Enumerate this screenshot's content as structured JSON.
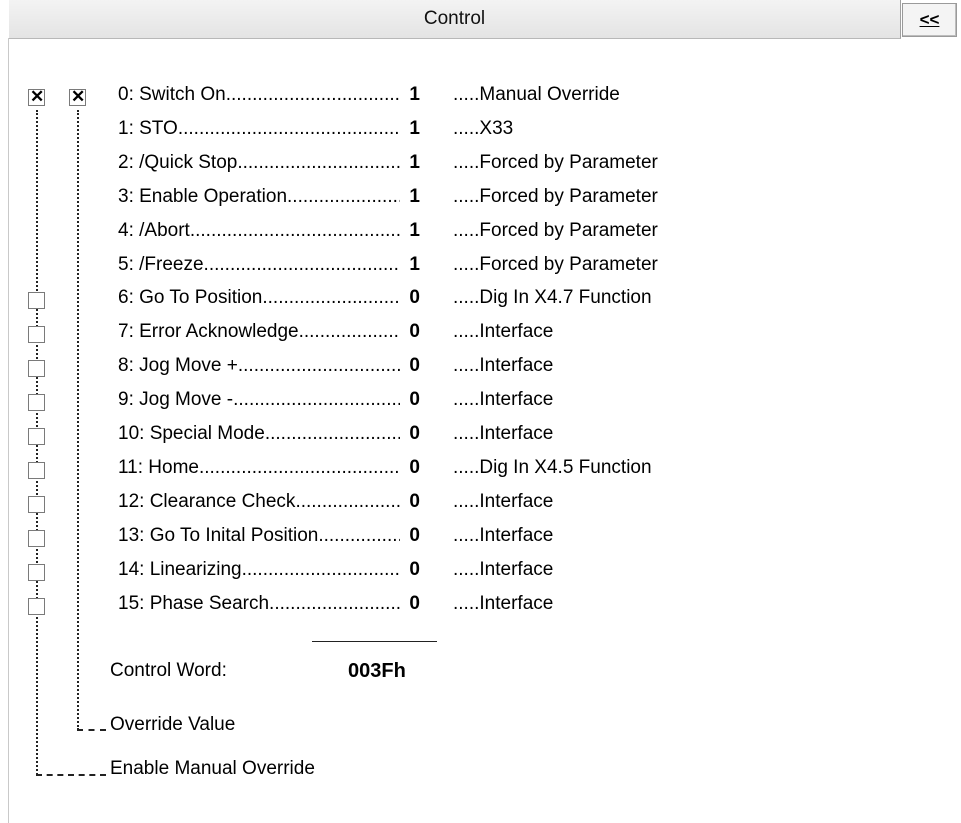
{
  "header": {
    "title": "Control",
    "collapse_label": "<<"
  },
  "bits": [
    {
      "label": "0: Switch On",
      "value": "1",
      "source": ".....Manual Override",
      "enable": true,
      "override": true
    },
    {
      "label": "1: STO",
      "value": "1",
      "source": ".....X33",
      "enable": null,
      "override": null
    },
    {
      "label": "2: /Quick Stop",
      "value": "1",
      "source": ".....Forced by Parameter",
      "enable": null,
      "override": null
    },
    {
      "label": "3: Enable Operation",
      "value": "1",
      "source": ".....Forced by Parameter",
      "enable": null,
      "override": null
    },
    {
      "label": "4: /Abort",
      "value": "1",
      "source": ".....Forced by Parameter",
      "enable": null,
      "override": null
    },
    {
      "label": "5: /Freeze",
      "value": "1",
      "source": ".....Forced by Parameter",
      "enable": null,
      "override": null
    },
    {
      "label": "6: Go To Position",
      "value": "0",
      "source": ".....Dig In X4.7 Function",
      "enable": false,
      "override": null
    },
    {
      "label": "7: Error Acknowledge",
      "value": "0",
      "source": ".....Interface",
      "enable": false,
      "override": null
    },
    {
      "label": "8: Jog Move +",
      "value": "0",
      "source": ".....Interface",
      "enable": false,
      "override": null
    },
    {
      "label": "9: Jog Move -",
      "value": "0",
      "source": ".....Interface",
      "enable": false,
      "override": null
    },
    {
      "label": "10: Special Mode",
      "value": "0",
      "source": ".....Interface",
      "enable": false,
      "override": null
    },
    {
      "label": "11: Home",
      "value": "0",
      "source": ".....Dig In X4.5 Function",
      "enable": false,
      "override": null
    },
    {
      "label": "12: Clearance Check",
      "value": "0",
      "source": ".....Interface",
      "enable": false,
      "override": null
    },
    {
      "label": "13: Go To Inital Position",
      "value": "0",
      "source": ".....Interface",
      "enable": false,
      "override": null
    },
    {
      "label": "14: Linearizing",
      "value": "0",
      "source": ".....Interface",
      "enable": false,
      "override": null
    },
    {
      "label": "15: Phase Search",
      "value": "0",
      "source": ".....Interface",
      "enable": false,
      "override": null
    }
  ],
  "control_word": {
    "label": "Control Word:",
    "value": "003Fh"
  },
  "legend": {
    "override_value": "Override Value",
    "enable_manual_override": "Enable Manual Override"
  }
}
